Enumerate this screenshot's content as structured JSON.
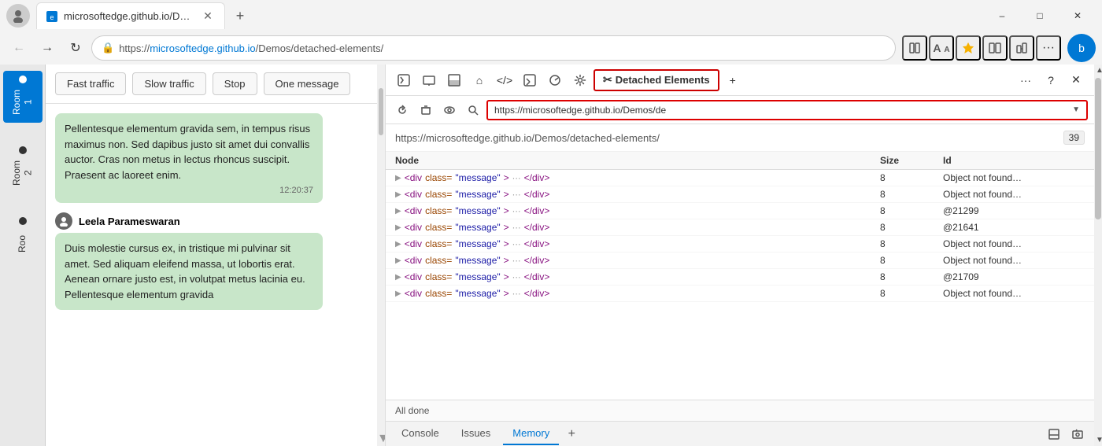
{
  "browser": {
    "tab_title": "microsoftedge.github.io/Demos/",
    "tab_favicon": "edge",
    "url_prefix": "https://microsoftedge.github.io",
    "url_path": "/Demos/detached-elements/",
    "url_full": "https://microsoftedge.github.io/Demos/detached-elements/",
    "window_minimize": "–",
    "window_maximize": "□",
    "window_close": "✕"
  },
  "chat_toolbar": {
    "btn_fast": "Fast traffic",
    "btn_slow": "Slow traffic",
    "btn_stop": "Stop",
    "btn_one": "One message"
  },
  "chat_rooms": [
    {
      "label": "Room 1",
      "active": true
    },
    {
      "label": "Room 2",
      "active": false
    },
    {
      "label": "Roo",
      "active": false
    }
  ],
  "messages": [
    {
      "text": "Pellentesque elementum gravida sem, in tempus risus maximus non. Sed dapibus justo sit amet dui convallis auctor. Cras non metus in lectus rhoncus suscipit. Praesent ac laoreet enim.",
      "time": "12:20:37",
      "sender": null
    },
    {
      "sender": "Leela Parameswaran",
      "text": "Duis molestie cursus ex, in tristique mi pulvinar sit amet. Sed aliquam eleifend massa, ut lobortis erat. Aenean ornare justo est, in volutpat metus lacinia eu. Pellentesque elementum gravida",
      "time": null
    }
  ],
  "devtools": {
    "tabs": [
      {
        "label": "⬚",
        "title": "Elements panel toggle",
        "active": false
      },
      {
        "label": "⧉",
        "title": "Console panel",
        "active": false
      },
      {
        "label": "◻",
        "title": "Source panel",
        "active": false
      },
      {
        "label": "⌂",
        "title": "Network panel",
        "active": false
      },
      {
        "label": "</>",
        "title": "Sources",
        "active": false
      },
      {
        "label": "☰",
        "title": "Performance",
        "active": false
      },
      {
        "label": "⚙",
        "title": "Memory",
        "active": false
      },
      {
        "label": "✂",
        "title": "Detached Elements",
        "active": true
      }
    ],
    "url_bar_value": "https://microsoftedge.github.io/Demos/de",
    "url_display": "https://microsoftedge.github.io/Demos/detached-elements/",
    "count_badge": "39",
    "table_headers": [
      "Node",
      "Size",
      "Id"
    ],
    "table_rows": [
      {
        "node": "<div class=\"message\"> … </div>",
        "size": "8",
        "id": "Object not found…"
      },
      {
        "node": "<div class=\"message\"> … </div>",
        "size": "8",
        "id": "Object not found…"
      },
      {
        "node": "<div class=\"message\"> … </div>",
        "size": "8",
        "id": "@21299"
      },
      {
        "node": "<div class=\"message\"> … </div>",
        "size": "8",
        "id": "@21641"
      },
      {
        "node": "<div class=\"message\"> … </div>",
        "size": "8",
        "id": "Object not found…"
      },
      {
        "node": "<div class=\"message\"> … </div>",
        "size": "8",
        "id": "Object not found…"
      },
      {
        "node": "<div class=\"message\"> … </div>",
        "size": "8",
        "id": "@21709"
      },
      {
        "node": "<div class=\"message\"> … </div>",
        "size": "8",
        "id": "Object not found…"
      }
    ],
    "status": "All done",
    "bottom_tabs": [
      "Console",
      "Issues",
      "Memory"
    ],
    "active_bottom_tab": "Memory"
  }
}
